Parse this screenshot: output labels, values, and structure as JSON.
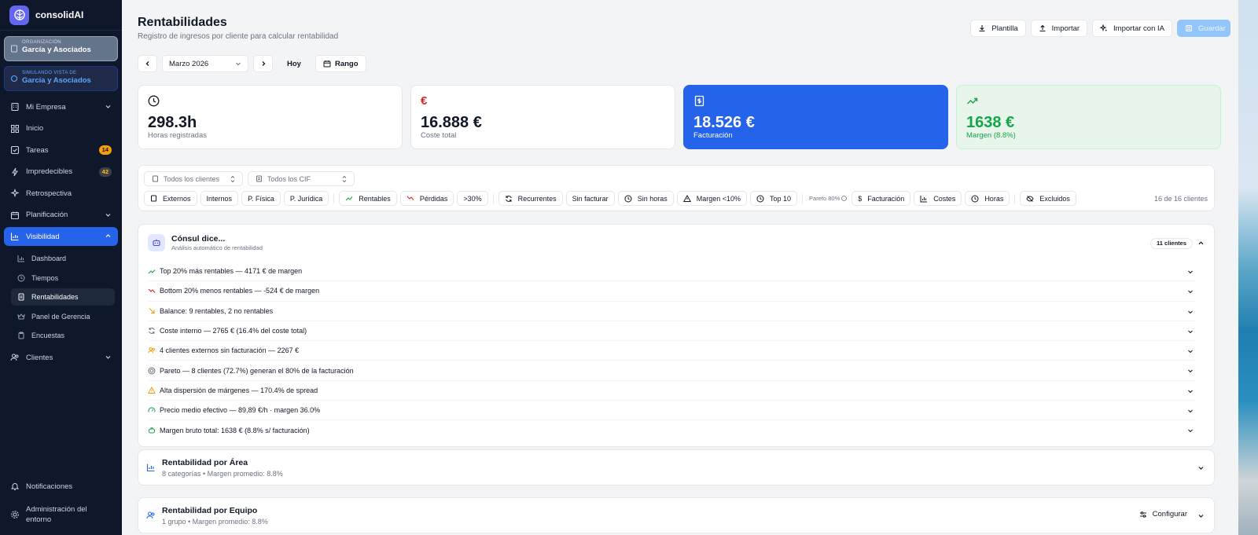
{
  "app": {
    "name": "consolidAI"
  },
  "org": {
    "small_label": "ORGANIZACIÓN",
    "name": "García y Asociados"
  },
  "sim": {
    "small_label": "SIMULANDO VISTA DE",
    "name": "García y Asociados"
  },
  "nav": {
    "mi_empresa": "Mi Empresa",
    "inicio": "Inicio",
    "tareas": "Tareas",
    "tareas_badge": "14",
    "impredecibles": "Impredecibles",
    "impredecibles_badge": "42",
    "retrospectiva": "Retrospectiva",
    "planificacion": "Planificación",
    "visibilidad": "Visibilidad",
    "sub": {
      "dashboard": "Dashboard",
      "tiempos": "Tiempos",
      "rentabilidades": "Rentabilidades",
      "panel": "Panel de Gerencia",
      "encuestas": "Encuestas"
    },
    "clientes": "Clientes",
    "notificaciones": "Notificaciones",
    "admin": "Administración del entorno"
  },
  "header": {
    "title": "Rentabilidades",
    "subtitle": "Registro de ingresos por cliente para calcular rentabilidad",
    "plantilla": "Plantilla",
    "importar": "Importar",
    "importar_ia": "Importar con IA",
    "guardar": "Guardar"
  },
  "datebar": {
    "month": "Marzo 2026",
    "hoy": "Hoy",
    "rango": "Rango"
  },
  "stats": {
    "horas": {
      "value": "298.3h",
      "label": "Horas registradas"
    },
    "coste": {
      "value": "16.888 €",
      "label": "Coste total"
    },
    "facturacion": {
      "value": "18.526 €",
      "label": "Facturación"
    },
    "margen": {
      "value": "1638 €",
      "label": "Margen (8.8%)"
    }
  },
  "filters": {
    "clientes_placeholder": "Todos los clientes",
    "cif_placeholder": "Todos los CIF",
    "externos": "Externos",
    "internos": "Internos",
    "pfisica": "P. Física",
    "pjuridica": "P. Jurídica",
    "rentables": "Rentables",
    "perdidas": "Pérdidas",
    "mas30": ">30%",
    "recurrentes": "Recurrentes",
    "sin_facturar": "Sin facturar",
    "sin_horas": "Sin horas",
    "margen10": "Margen <10%",
    "top10": "Top 10",
    "pareto": "Pareto 80%",
    "facturacion": "Facturación",
    "costes": "Costes",
    "horas": "Horas",
    "excluidos": "Excluidos",
    "count": "16 de 16 clientes"
  },
  "consul": {
    "title": "Cónsul dice...",
    "subtitle": "Análisis automático de rentabilidad",
    "clients": "11 clientes",
    "insights": [
      "Top 20% más rentables — 4171 € de margen",
      "Bottom 20% menos rentables — -524 € de margen",
      "Balance: 9 rentables, 2 no rentables",
      "Coste interno — 2765 € (16.4% del coste total)",
      "4 clientes externos sin facturación — 2267 €",
      "Pareto — 8 clientes (72.7%) generan el 80% de la facturación",
      "Alta dispersión de márgenes — 170.4% de spread",
      "Precio medio efectivo — 89,89 €/h · margen 36.0%",
      "Margen bruto total: 1638 € (8.8% s/ facturación)"
    ]
  },
  "area": {
    "title": "Rentabilidad por Área",
    "subtitle": "8 categorías • Margen promedio: 8.8%"
  },
  "equipo": {
    "title": "Rentabilidad por Equipo",
    "subtitle": "1 grupo • Margen promedio: 8.8%",
    "configurar": "Configurar"
  },
  "colors": {
    "accent": "#2563eb",
    "sidebar": "#0f172a",
    "green": "#16a34a",
    "red": "#dc2626"
  }
}
